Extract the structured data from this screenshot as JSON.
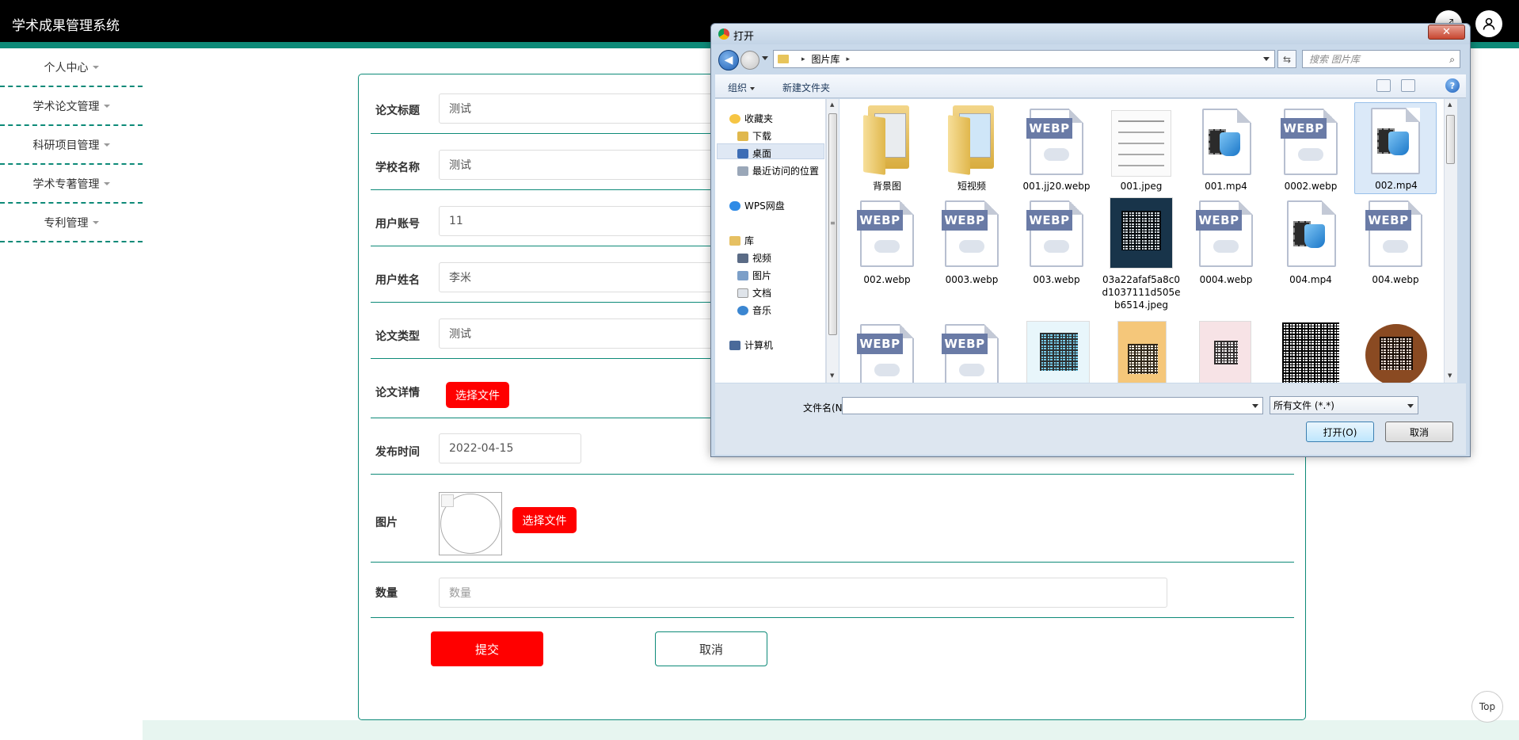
{
  "app": {
    "title": "学术成果管理系统"
  },
  "header": {
    "fullscreen_icon": "fullscreen-icon",
    "user_icon": "user-icon"
  },
  "sidebar": {
    "items": [
      {
        "label": "个人中心"
      },
      {
        "label": "学术论文管理"
      },
      {
        "label": "科研项目管理"
      },
      {
        "label": "学术专著管理"
      },
      {
        "label": "专利管理"
      }
    ]
  },
  "form": {
    "fields": {
      "title": {
        "label": "论文标题",
        "value": "测试"
      },
      "school": {
        "label": "学校名称",
        "value": "测试"
      },
      "account": {
        "label": "用户账号",
        "value": "11"
      },
      "name": {
        "label": "用户姓名",
        "value": "李米"
      },
      "type": {
        "label": "论文类型",
        "value": "测试"
      },
      "detail": {
        "label": "论文详情",
        "button": "选择文件"
      },
      "date": {
        "label": "发布时间",
        "value": "2022-04-15"
      },
      "image": {
        "label": "图片",
        "button": "选择文件"
      },
      "quantity": {
        "label": "数量",
        "placeholder": "数量"
      }
    },
    "submit": "提交",
    "cancel": "取消"
  },
  "top_button": "Top",
  "dialog": {
    "title": "打开",
    "close_icon": "close-icon",
    "path": {
      "root_arrow": "▸",
      "folder": "图片库",
      "end_arrow": "▸"
    },
    "search_placeholder": "搜索 图片库",
    "toolbar": {
      "organize": "组织",
      "new_folder": "新建文件夹"
    },
    "nav": {
      "favorites": "收藏夹",
      "downloads": "下载",
      "desktop": "桌面",
      "recent": "最近访问的位置",
      "wps": "WPS网盘",
      "library": "库",
      "videos": "视频",
      "pictures": "图片",
      "documents": "文档",
      "music": "音乐",
      "computer": "计算机"
    },
    "files": [
      {
        "name": "背景图",
        "kind": "folder"
      },
      {
        "name": "短视频",
        "kind": "folder"
      },
      {
        "name": "001.jj20.webp",
        "kind": "webp"
      },
      {
        "name": "001.jpeg",
        "kind": "image"
      },
      {
        "name": "001.mp4",
        "kind": "video"
      },
      {
        "name": "0002.webp",
        "kind": "webp"
      },
      {
        "name": "002.mp4",
        "kind": "video",
        "selected": true
      },
      {
        "name": "002.webp",
        "kind": "webp"
      },
      {
        "name": "0003.webp",
        "kind": "webp"
      },
      {
        "name": "003.webp",
        "kind": "webp"
      },
      {
        "name": "03a22afaf5a8c0d1037111d505eb6514.jpeg",
        "kind": "qr"
      },
      {
        "name": "0004.webp",
        "kind": "webp"
      },
      {
        "name": "004.mp4",
        "kind": "video"
      },
      {
        "name": "004.webp",
        "kind": "webp"
      }
    ],
    "webp_badge": "WEBP",
    "filename_label": "文件名(N):",
    "filename_value": "",
    "filetype": "所有文件 (*.*)",
    "open": "打开(O)",
    "cancel": "取消"
  }
}
